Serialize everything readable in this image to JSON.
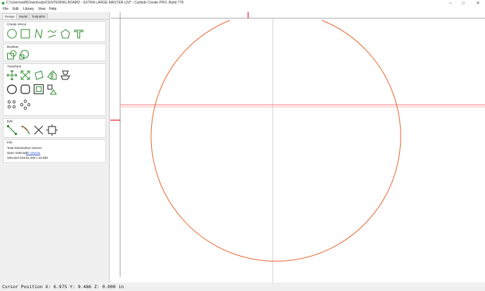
{
  "window": {
    "title": "C:\\Users\\willi\\Downloads\\CENTERING BOARD - EXTRA LARGE MASTER.c2d* - Carbide Create PRO, Build 778",
    "minimize": "–",
    "maximize": "□",
    "close": "✕"
  },
  "menu": [
    "File",
    "Edit",
    "Library",
    "View",
    "Help"
  ],
  "tabs": [
    {
      "label": "Design",
      "active": true
    },
    {
      "label": "Model",
      "active": false
    },
    {
      "label": "Toolpaths",
      "active": false
    }
  ],
  "panels": {
    "create_vector": {
      "title": "Create Vector",
      "tools": [
        "circle-icon",
        "rectangle-icon",
        "curve-icon",
        "polygon-icon",
        "text-icon"
      ]
    },
    "boolean": {
      "title": "Boolean",
      "tools": [
        "union-icon",
        "intersect-icon"
      ]
    },
    "transform": {
      "title": "Transform",
      "tools": [
        "move-icon",
        "scale-icon",
        "rotate-icon",
        "mirror-icon",
        "shear-icon",
        "smooth-icon",
        "offset-icon",
        "inset-icon",
        "array-icon",
        "align-icon",
        "circular-array-icon",
        "pattern-icon"
      ]
    },
    "edit": {
      "title": "Edit",
      "tools": [
        "node-edit-icon",
        "trim-icon",
        "cut-icon",
        "bounding-box-icon"
      ]
    },
    "info": {
      "title": "Info",
      "total_selected_label": "Total Selected:",
      "total_selected_value": "112 Vectors",
      "open_selected_label": "Open Selected:",
      "open_selected_value": "57 Vectors",
      "selected_size_label": "Selected Size:",
      "selected_size_value": "51.490 x 34.839"
    }
  },
  "status": {
    "cursor_position": "Cursor Position X: 6.975 Y: 9.486 Z: 0.000 in"
  },
  "colors": {
    "tool_green": "#2e8b2e",
    "circle_orange": "#e8632b",
    "guide_red": "#ff4d4d",
    "axis_gray": "#b0b0b0"
  }
}
